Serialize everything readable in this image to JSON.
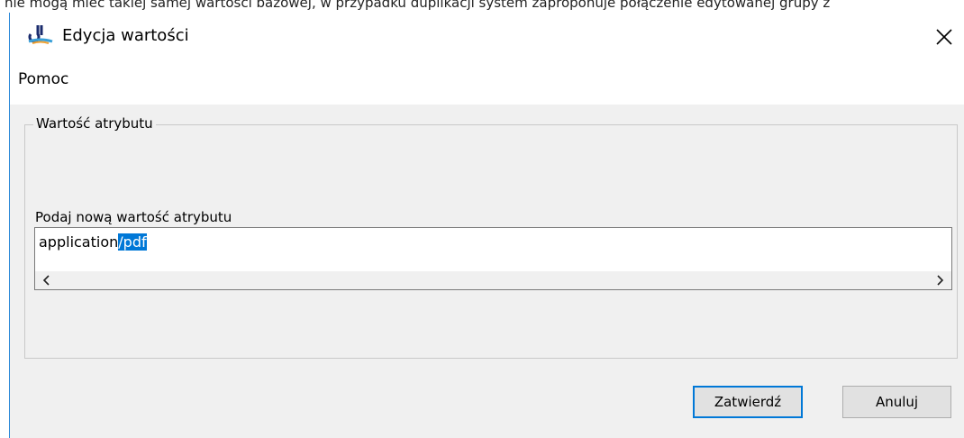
{
  "background_text": "nie mogą mieć takiej samej wartości bazowej, w przypadku duplikacji system zaproponuje połączenie edytowanej grupy z",
  "window": {
    "title": "Edycja wartości",
    "accent": "#0078d7"
  },
  "menu": {
    "items": [
      {
        "label": "Pomoc"
      }
    ]
  },
  "group": {
    "legend": "Wartość atrybutu",
    "field_label": "Podaj nową wartość atrybutu",
    "value_unselected": "application",
    "value_selected": "/pdf",
    "scroll_left_icon": "chevron-left-icon",
    "scroll_right_icon": "chevron-right-icon"
  },
  "buttons": {
    "confirm": "Zatwierdź",
    "cancel": "Anuluj"
  }
}
